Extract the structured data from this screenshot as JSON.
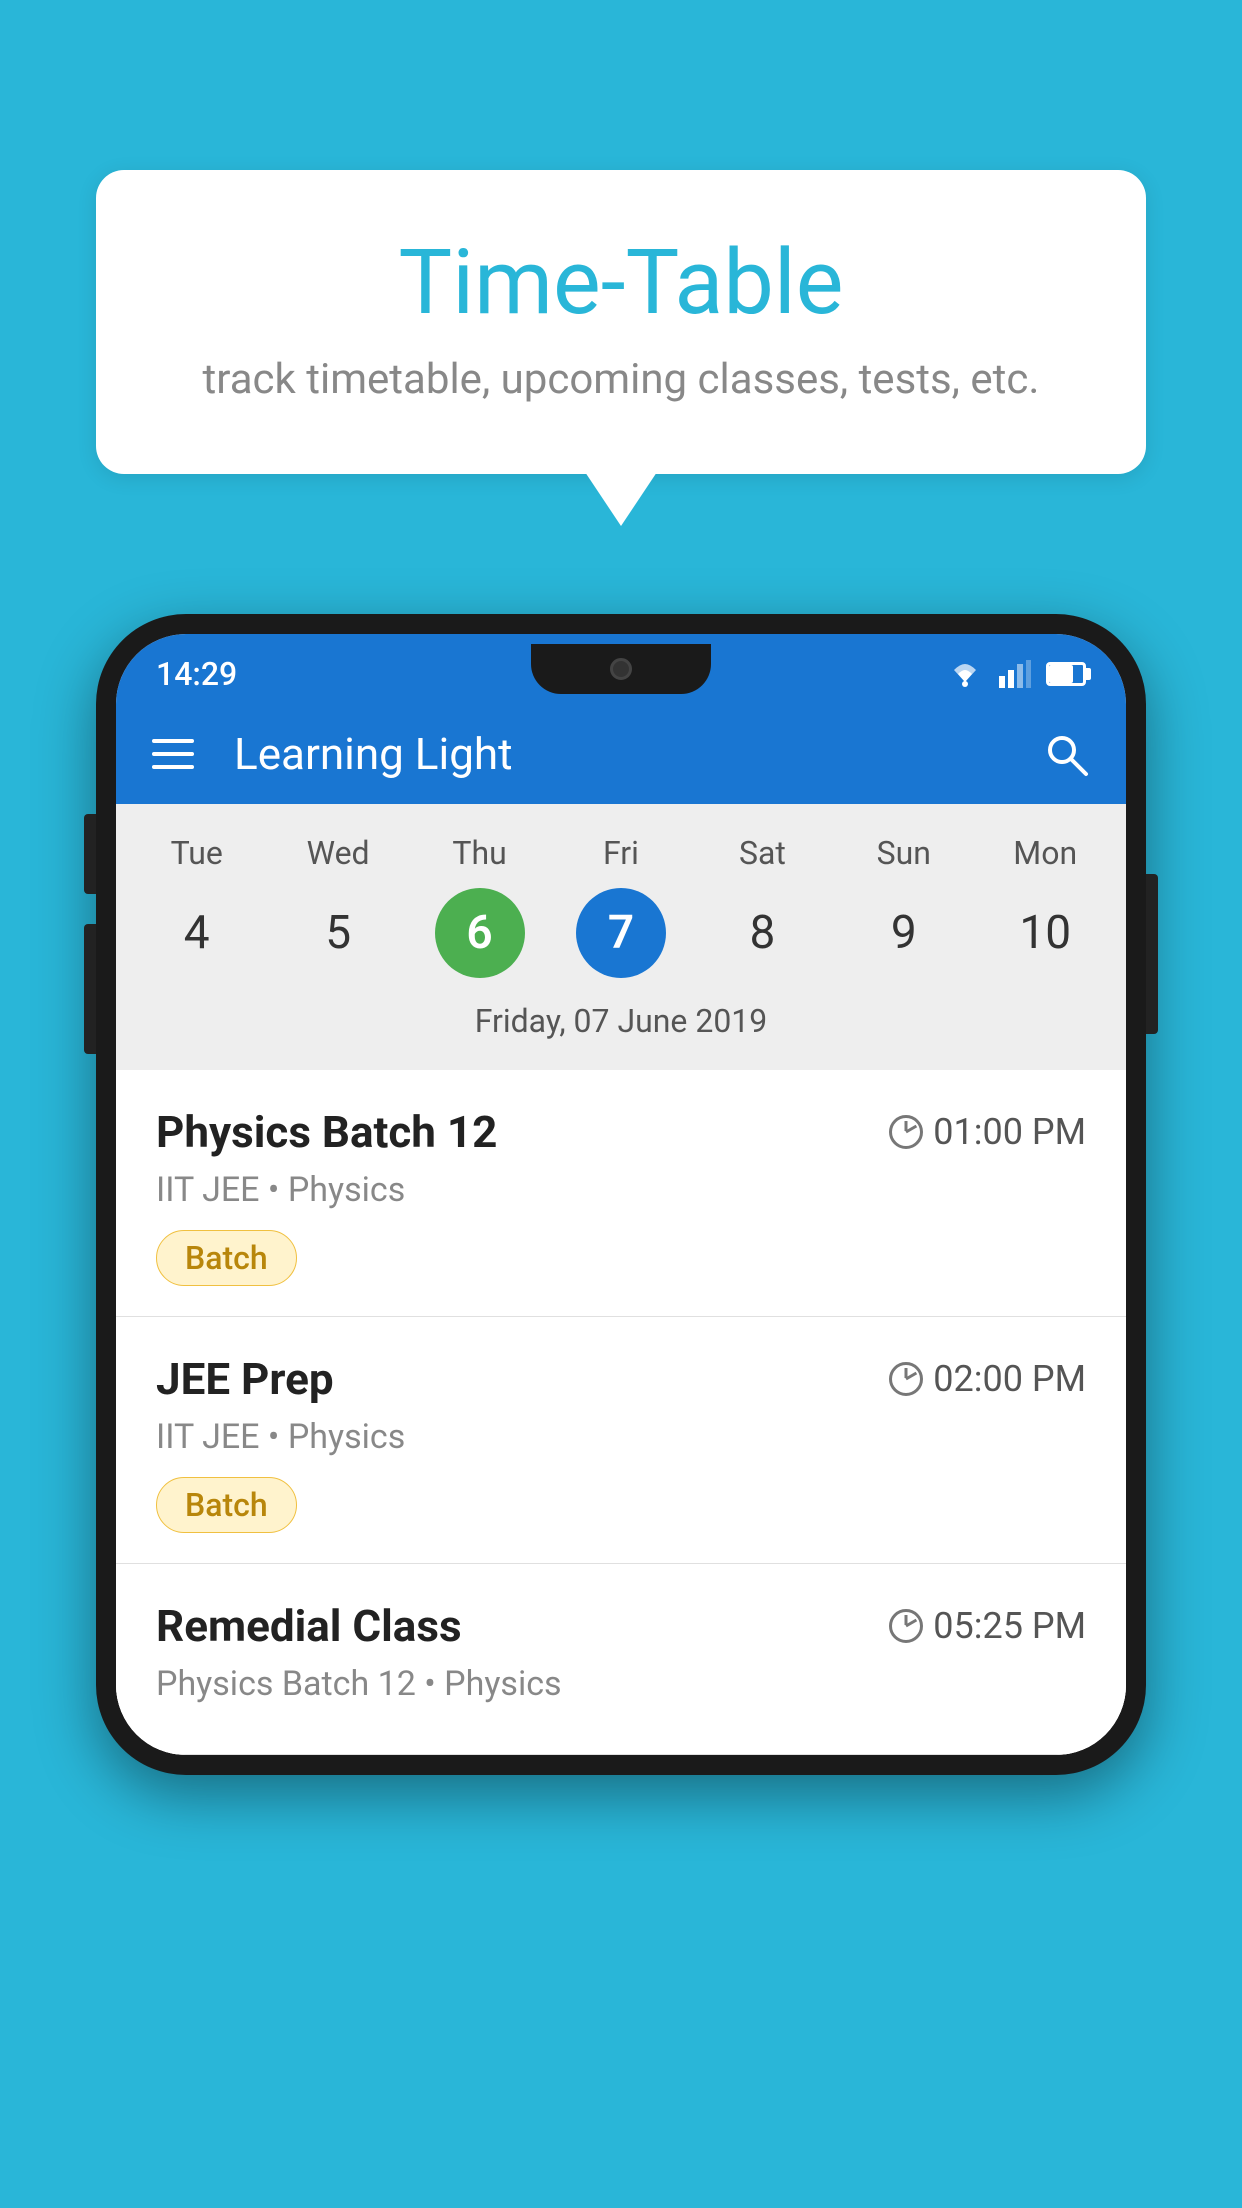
{
  "background_color": "#29B6D8",
  "bubble": {
    "title": "Time-Table",
    "subtitle": "track timetable, upcoming classes, tests, etc."
  },
  "phone": {
    "status_bar": {
      "time": "14:29"
    },
    "app_bar": {
      "title": "Learning Light"
    },
    "calendar": {
      "days": [
        {
          "label": "Tue",
          "number": "4",
          "state": "normal"
        },
        {
          "label": "Wed",
          "number": "5",
          "state": "normal"
        },
        {
          "label": "Thu",
          "number": "6",
          "state": "today"
        },
        {
          "label": "Fri",
          "number": "7",
          "state": "selected"
        },
        {
          "label": "Sat",
          "number": "8",
          "state": "normal"
        },
        {
          "label": "Sun",
          "number": "9",
          "state": "normal"
        },
        {
          "label": "Mon",
          "number": "10",
          "state": "normal"
        }
      ],
      "selected_date_label": "Friday, 07 June 2019"
    },
    "classes": [
      {
        "name": "Physics Batch 12",
        "time": "01:00 PM",
        "meta": "IIT JEE • Physics",
        "badge": "Batch"
      },
      {
        "name": "JEE Prep",
        "time": "02:00 PM",
        "meta": "IIT JEE • Physics",
        "badge": "Batch"
      },
      {
        "name": "Remedial Class",
        "time": "05:25 PM",
        "meta": "Physics Batch 12 • Physics",
        "badge": ""
      }
    ]
  }
}
